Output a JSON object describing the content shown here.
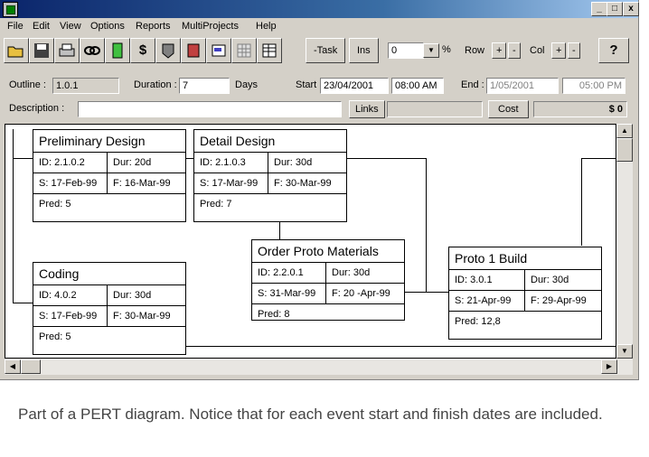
{
  "menu": [
    "File",
    "Edit",
    "View",
    "Options",
    "Reports",
    "MultiProjects",
    "Help"
  ],
  "window_controls": {
    "minimize": "_",
    "maximize": "□",
    "close": "x"
  },
  "toolbar": {
    "task_label": "-Task",
    "ins_label": "Ins",
    "percent_value": "0",
    "percent_sign": "%",
    "row_label": "Row",
    "col_label": "Col",
    "plus": "+",
    "minus": "-",
    "help_label": "?",
    "icons": [
      "open-folder-icon",
      "save-disk-icon",
      "print-icon",
      "link-icon",
      "page-icon",
      "dollar-icon",
      "resource-icon",
      "calendar-icon",
      "chart-icon",
      "grid-icon",
      "table-icon"
    ]
  },
  "fields": {
    "outline_label": "Outline :",
    "outline_value": "1.0.1",
    "duration_label": "Duration :",
    "duration_value": "7",
    "days_label": "Days",
    "start_label": "Start",
    "start_date": "23/04/2001",
    "start_time": "08:00 AM",
    "end_label": "End :",
    "end_date": "1/05/2001",
    "end_time": "05:00 PM",
    "description_label": "Description :",
    "description_value": "",
    "links_label": "Links",
    "cost_label": "Cost",
    "cost_value": "$ 0"
  },
  "nodes": [
    {
      "title": "Preliminary Design",
      "id": "ID: 2.1.0.2",
      "dur": "Dur: 20d",
      "start": "S: 17-Feb-99",
      "finish": "F: 16-Mar-99",
      "pred": "Pred: 5"
    },
    {
      "title": "Detail Design",
      "id": "ID: 2.1.0.3",
      "dur": "Dur: 30d",
      "start": "S: 17-Mar-99",
      "finish": "F: 30-Mar-99",
      "pred": "Pred: 7"
    },
    {
      "title": "Order Proto Materials",
      "id": "ID: 2.2.0.1",
      "dur": "Dur: 30d",
      "start": "S: 31-Mar-99",
      "finish": "F: 20 -Apr-99",
      "pred": "Pred: 8"
    },
    {
      "title": "Proto 1 Build",
      "id": "ID: 3.0.1",
      "dur": "Dur: 30d",
      "start": "S: 21-Apr-99",
      "finish": "F: 29-Apr-99",
      "pred": "Pred: 12,8"
    },
    {
      "title": "Coding",
      "id": "ID: 4.0.2",
      "dur": "Dur: 30d",
      "start": "S: 17-Feb-99",
      "finish": "F: 30-Mar-99",
      "pred": "Pred: 5"
    }
  ],
  "caption": "Part of a PERT diagram. Notice that for each event start and finish dates are included."
}
